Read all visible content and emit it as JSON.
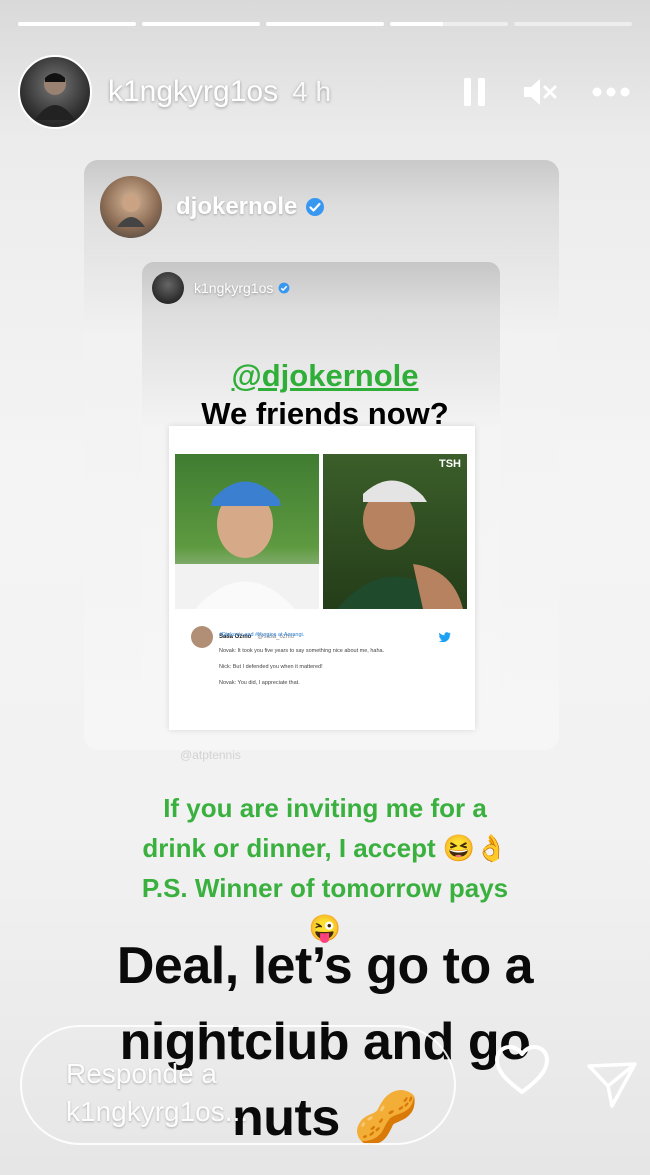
{
  "story": {
    "progress_segments": [
      {
        "fill": 1.0
      },
      {
        "fill": 1.0
      },
      {
        "fill": 1.0
      },
      {
        "fill": 0.45
      },
      {
        "fill": 0.0
      }
    ],
    "username": "k1ngkyrg1os",
    "time_ago": "4 h",
    "pause_icon": "pause-icon",
    "mute_icon": "volume-muted-icon",
    "more_icon": "more-icon"
  },
  "repost": {
    "username": "djokernole",
    "verified_icon": "verified-icon",
    "inner": {
      "username": "k1ngkyrg1os",
      "mention": "@djokernole",
      "question": "We friends now?",
      "post": {
        "badge": "TSH",
        "tweet_author": "Saša Ozmo",
        "tweet_handle": "@sasa_ozmo",
        "tweet_sub": "#Djokovic and #Kyrgios at Aorangi.",
        "lines": [
          "Novak: It took you five years to say something nice about me, haha.",
          "Nick: But I defended you when it mattered!",
          "Novak: You did, I appreciate that."
        ]
      },
      "watermark": "@atptennis"
    },
    "reply_lines": [
      "If you are inviting me for a",
      "drink or dinner, I accept 😆👌",
      "P.S. Winner of tomorrow pays",
      "😜"
    ]
  },
  "caption_lines": [
    "Deal, let’s go to a",
    "nightclub and go",
    "nuts 🥜"
  ],
  "footer": {
    "reply_placeholder_lines": [
      "Responde a",
      "k1ngkyrg1os..."
    ],
    "heart_icon": "heart-icon",
    "send_icon": "send-icon"
  }
}
